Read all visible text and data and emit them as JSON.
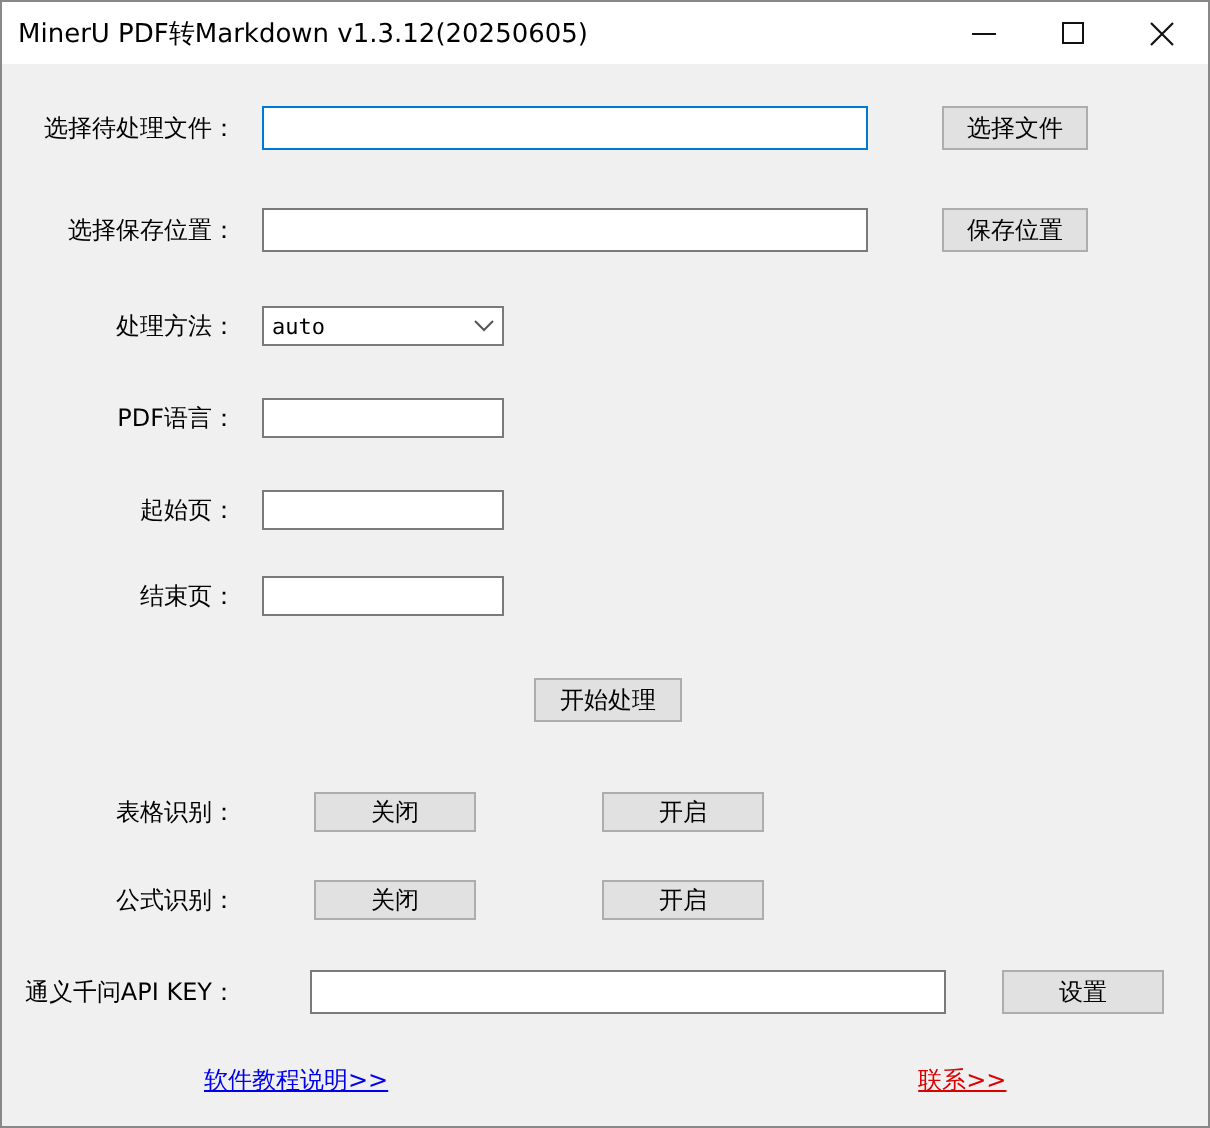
{
  "window": {
    "title": "MinerU PDF转Markdown v1.3.12(20250605)"
  },
  "file_rows": [
    {
      "label": "选择待处理文件：",
      "button": "选择文件",
      "focused": true
    },
    {
      "label": "选择保存位置：",
      "button": "保存位置",
      "focused": false
    }
  ],
  "options": [
    {
      "kind": "combo",
      "label": "处理方法：",
      "value": "auto"
    },
    {
      "kind": "text",
      "label": "PDF语言："
    },
    {
      "kind": "text",
      "label": "起始页："
    },
    {
      "kind": "text",
      "label": "结束页："
    }
  ],
  "process_button": "开始处理",
  "toggles": [
    {
      "label": "表格识别：",
      "buttons": [
        "关闭",
        "开启"
      ]
    },
    {
      "label": "公式识别：",
      "buttons": [
        "关闭",
        "开启"
      ]
    }
  ],
  "api": {
    "label": "通义千问API KEY：",
    "button": "设置"
  },
  "links": [
    {
      "text": "软件教程说明>>",
      "color": "#0000ee"
    },
    {
      "text": "联系>>",
      "color": "#dd0000"
    }
  ]
}
